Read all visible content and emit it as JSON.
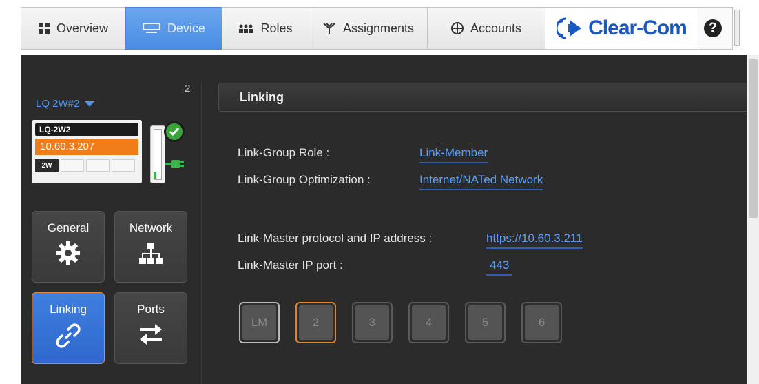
{
  "nav": {
    "tabs": [
      {
        "label": "Overview",
        "icon": "grid-icon",
        "active": false
      },
      {
        "label": "Device",
        "icon": "device-icon",
        "active": true
      },
      {
        "label": "Roles",
        "icon": "roles-icon",
        "active": false
      },
      {
        "label": "Assignments",
        "icon": "assignments-icon",
        "active": false
      },
      {
        "label": "Accounts",
        "icon": "accounts-icon",
        "active": false
      }
    ],
    "brand": "Clear-Com",
    "help": "?"
  },
  "sidebar": {
    "device_count": "2",
    "device_selector": "LQ 2W#2",
    "device_card": {
      "model": "LQ-2W2",
      "ip": "10.60.3.207",
      "port_type": "2W"
    },
    "tiles": [
      {
        "label": "General",
        "icon": "gear-icon",
        "active": false
      },
      {
        "label": "Network",
        "icon": "network-icon",
        "active": false
      },
      {
        "label": "Linking",
        "icon": "link-icon",
        "active": true
      },
      {
        "label": "Ports",
        "icon": "arrows-icon",
        "active": false
      }
    ]
  },
  "main": {
    "section_title": "Linking",
    "fields": {
      "role_label": "Link-Group Role :",
      "role_value": "Link-Member",
      "optimization_label": "Link-Group Optimization :",
      "optimization_value": "Internet/NATed Network",
      "master_ip_label": "Link-Master protocol and IP address :",
      "master_ip_value": "https://10.60.3.211",
      "master_port_label": "Link-Master IP port :",
      "master_port_value": "443"
    },
    "nodes": [
      "LM",
      "2",
      "3",
      "4",
      "5",
      "6"
    ]
  },
  "colors": {
    "accent_blue": "#4a8ce4",
    "link_blue": "#5aa0ff",
    "ip_orange": "#f07d1a",
    "status_green": "#3aa33a",
    "panel_bg": "#2b2b2b"
  }
}
